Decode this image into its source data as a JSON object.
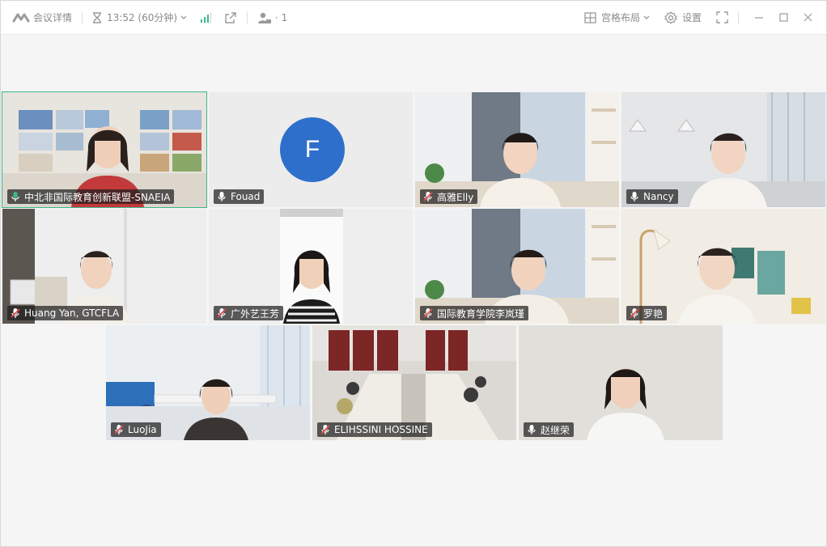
{
  "titlebar": {
    "meeting_details": "会议详情",
    "time": "13:52 (60分钟)",
    "participants_count": "· 1",
    "layout_label": "宫格布局",
    "settings_label": "设置"
  },
  "tiles": [
    {
      "name": "中北非国际教育创新联盟-SNAEIA",
      "mic": "green-mic",
      "active": true
    },
    {
      "name": "Fouad",
      "mic": "mic",
      "avatar_letter": "F"
    },
    {
      "name": "高雅Elly",
      "mic": "muted-mic"
    },
    {
      "name": "Nancy",
      "mic": "mic"
    },
    {
      "name": "Huang Yan, GTCFLA",
      "mic": "muted-mic"
    },
    {
      "name": "广外艺王芳",
      "mic": "muted-mic"
    },
    {
      "name": "国际教育学院李岚瑾",
      "mic": "muted-mic"
    },
    {
      "name": "罗艳",
      "mic": "muted-mic"
    },
    {
      "name": "LuoJia",
      "mic": "muted-mic"
    },
    {
      "name": "ELIHSSINI HOSSINE",
      "mic": "muted-mic"
    },
    {
      "name": "赵继荣",
      "mic": "mic"
    }
  ],
  "colors": {
    "accent_green": "#3bb98a",
    "avatar_blue": "#2f6fcc",
    "muted_red": "#e54545"
  }
}
